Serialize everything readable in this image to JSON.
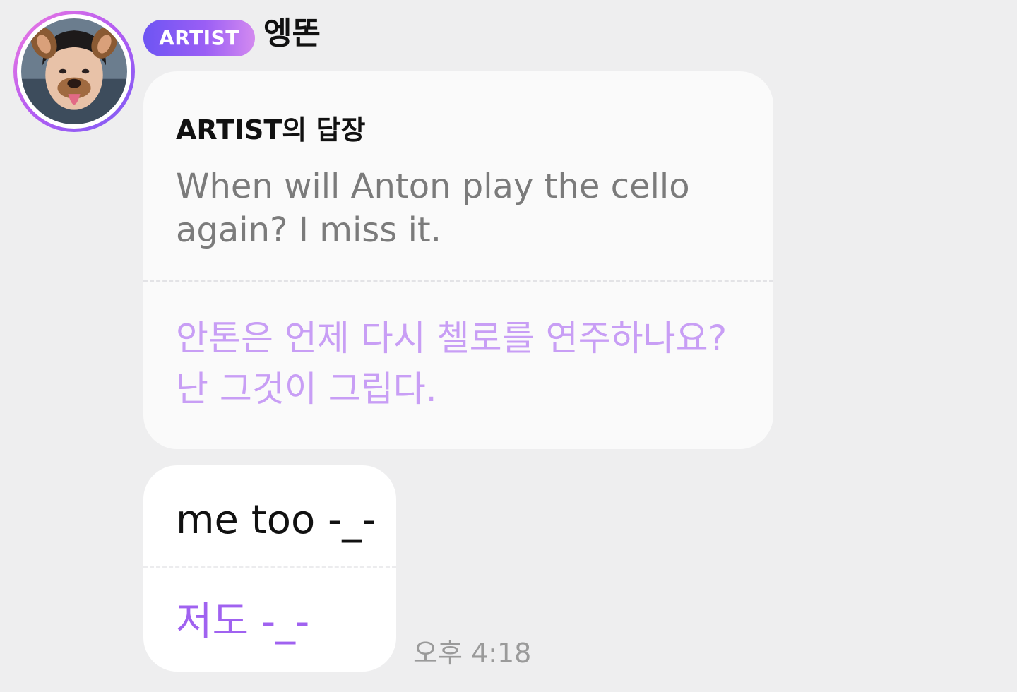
{
  "sender": {
    "badge": "ARTIST",
    "name": "엥똔",
    "avatar": "profile-photo"
  },
  "reply": {
    "header": "ARTIST의 답장",
    "original_text": "When will Anton play the cello again? I miss it.",
    "translation": "안톤은 언제 다시 첼로를 연주하나요? 난 그것이 그립다."
  },
  "message": {
    "text": "me too -_-",
    "translation": "저도 -_-",
    "time": "오후 4:18"
  },
  "colors": {
    "background": "#eeeeef",
    "bubble": "#fafafa",
    "badge_start": "#6e55f3",
    "badge_end": "#d38af0",
    "translation_light": "#c89ef5",
    "translation_accent": "#a062f0"
  }
}
